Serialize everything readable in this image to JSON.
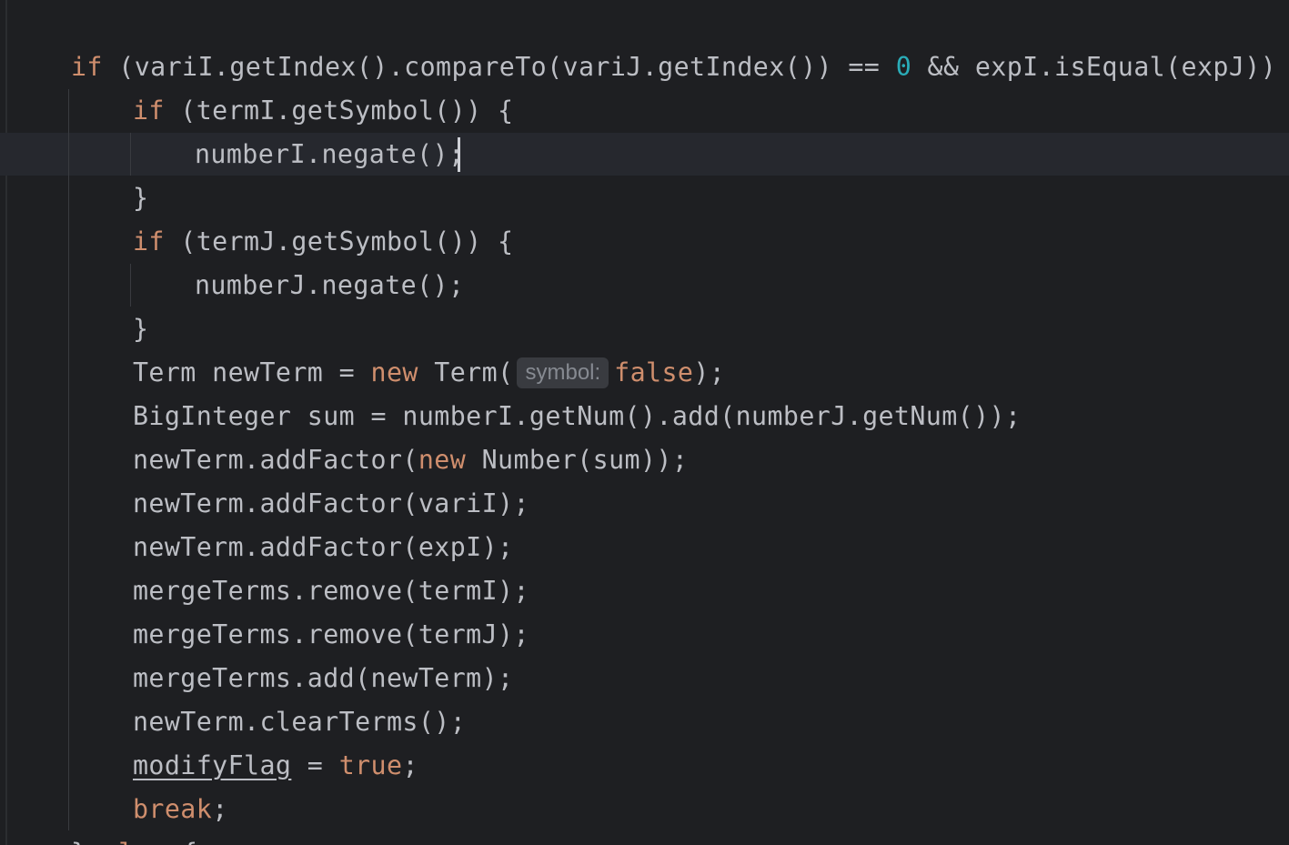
{
  "editor": {
    "language": "java",
    "caret_line": 3,
    "lines": [
      {
        "id": 1,
        "tokens": [
          {
            "t": "if",
            "c": "kw"
          },
          {
            "t": " (variI.getIndex().compareTo(variJ.getIndex()) == "
          },
          {
            "t": "0",
            "c": "num"
          },
          {
            "t": " && expI.isEqual(expJ)) {"
          }
        ]
      },
      {
        "id": 2,
        "tokens": [
          {
            "t": "if",
            "c": "kw"
          },
          {
            "t": " (termI.getSymbol()) {"
          }
        ]
      },
      {
        "id": 3,
        "tokens": [
          {
            "t": "numberI.negate();"
          }
        ]
      },
      {
        "id": 4,
        "tokens": [
          {
            "t": "}"
          }
        ]
      },
      {
        "id": 5,
        "tokens": [
          {
            "t": "if",
            "c": "kw"
          },
          {
            "t": " (termJ.getSymbol()) {"
          }
        ]
      },
      {
        "id": 6,
        "tokens": [
          {
            "t": "numberJ.negate();"
          }
        ]
      },
      {
        "id": 7,
        "tokens": [
          {
            "t": "}"
          }
        ]
      },
      {
        "id": 8,
        "tokens": [
          {
            "t": "Term newTerm = "
          },
          {
            "t": "new",
            "c": "kw"
          },
          {
            "t": " Term("
          },
          {
            "t": "symbol:",
            "c": "hint"
          },
          {
            "t": "false",
            "c": "kw"
          },
          {
            "t": ");"
          }
        ]
      },
      {
        "id": 9,
        "tokens": [
          {
            "t": "BigInteger sum = numberI.getNum().add(numberJ.getNum());"
          }
        ]
      },
      {
        "id": 10,
        "tokens": [
          {
            "t": "newTerm.addFactor("
          },
          {
            "t": "new",
            "c": "kw"
          },
          {
            "t": " Number(sum));"
          }
        ]
      },
      {
        "id": 11,
        "tokens": [
          {
            "t": "newTerm.addFactor(variI);"
          }
        ]
      },
      {
        "id": 12,
        "tokens": [
          {
            "t": "newTerm.addFactor(expI);"
          }
        ]
      },
      {
        "id": 13,
        "tokens": [
          {
            "t": "mergeTerms.remove(termI);"
          }
        ]
      },
      {
        "id": 14,
        "tokens": [
          {
            "t": "mergeTerms.remove(termJ);"
          }
        ]
      },
      {
        "id": 15,
        "tokens": [
          {
            "t": "mergeTerms.add(newTerm);"
          }
        ]
      },
      {
        "id": 16,
        "tokens": [
          {
            "t": "newTerm.clearTerms();"
          }
        ]
      },
      {
        "id": 17,
        "tokens": [
          {
            "t": "modifyFlag",
            "c": "field"
          },
          {
            "t": " = "
          },
          {
            "t": "true",
            "c": "kw"
          },
          {
            "t": ";"
          }
        ]
      },
      {
        "id": 18,
        "tokens": [
          {
            "t": "break",
            "c": "kw"
          },
          {
            "t": ";"
          }
        ]
      },
      {
        "id": 19,
        "tokens": [
          {
            "t": "} "
          },
          {
            "t": "else",
            "c": "kw"
          },
          {
            "t": " {"
          }
        ]
      }
    ]
  },
  "colors": {
    "background": "#1e1f22",
    "text": "#bcbec4",
    "keyword": "#cf8e6d",
    "number": "#2aacb8",
    "inlay_hint_bg": "#393b40",
    "inlay_hint_text": "#868a91",
    "current_line": "#26282e"
  }
}
